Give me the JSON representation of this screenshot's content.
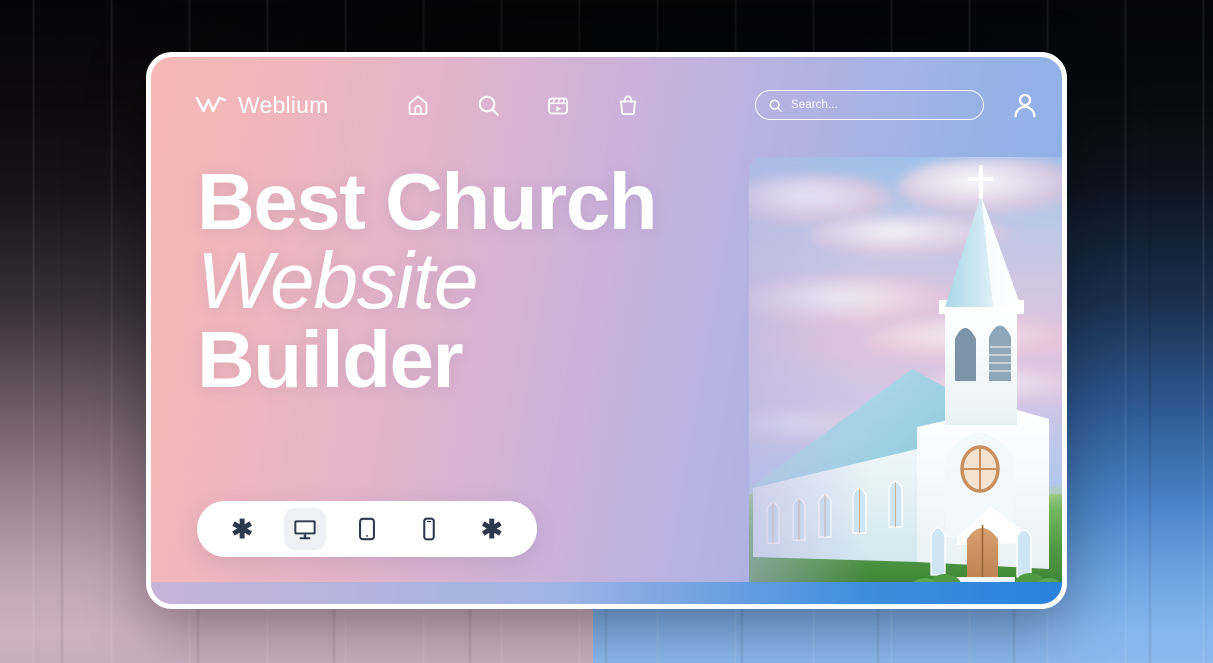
{
  "card": {
    "accent_pink": "#f6b8b6",
    "accent_blue": "#88b0e8",
    "border_color": "#ffffff"
  },
  "navbar": {
    "brand": {
      "logo_icon": "weblium-w-logo-icon",
      "name": "Weblium"
    },
    "icons": [
      {
        "name": "home-icon",
        "label": "Home"
      },
      {
        "name": "search-icon",
        "label": "Search"
      },
      {
        "name": "video-clapperboard-icon",
        "label": "Videos"
      },
      {
        "name": "shopping-bag-icon",
        "label": "Shop"
      }
    ],
    "search": {
      "icon": "search-icon",
      "placeholder": "Search...",
      "value": ""
    },
    "account": {
      "icon": "user-avatar-icon",
      "label": "Account"
    }
  },
  "hero": {
    "line1": "Best Church",
    "line2": "Website",
    "line3": "Builder",
    "image_alt": "white church with blue roof and steeple"
  },
  "device_toolbar": {
    "buttons": [
      {
        "name": "sparkle-left-button",
        "icon": "asterisk-icon",
        "glyph": "✱",
        "active": false
      },
      {
        "name": "desktop-view-button",
        "icon": "desktop-monitor-icon",
        "active": true
      },
      {
        "name": "tablet-view-button",
        "icon": "tablet-icon",
        "active": false
      },
      {
        "name": "mobile-view-button",
        "icon": "mobile-phone-icon",
        "active": false
      },
      {
        "name": "sparkle-right-button",
        "icon": "asterisk-icon",
        "glyph": "✱",
        "active": false
      }
    ],
    "active_index": 1
  }
}
